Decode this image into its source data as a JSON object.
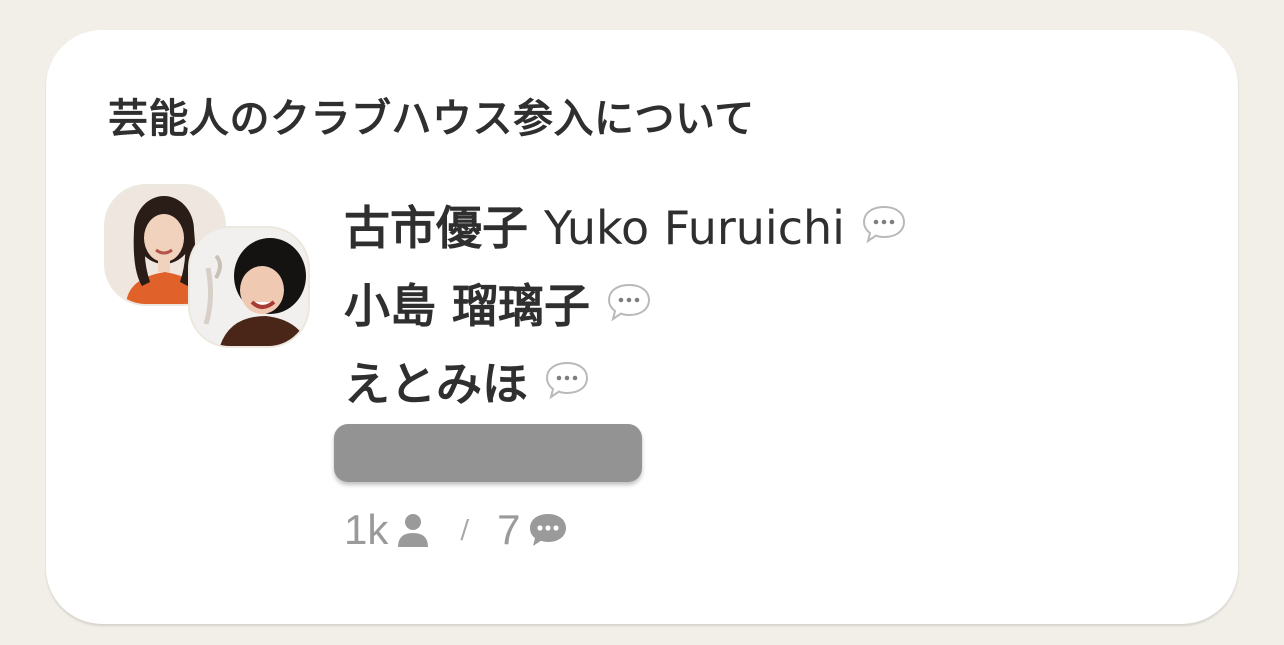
{
  "room": {
    "title": "芸能人のクラブハウス参入について",
    "speakers": [
      {
        "name": "古市優子",
        "name_latin": "Yuko Furuichi",
        "icon": "speech-bubble-icon"
      },
      {
        "name": "小島 瑠璃子",
        "name_latin": "",
        "icon": "speech-bubble-icon"
      },
      {
        "name": "えとみほ",
        "name_latin": "",
        "icon": "speech-bubble-icon"
      }
    ],
    "stats": {
      "listeners": "1k",
      "listeners_icon": "person-icon",
      "separator": "/",
      "speakers": "7",
      "speakers_icon": "chat-bubble-icon"
    }
  },
  "colors": {
    "background": "#f1efe7",
    "card": "#ffffff",
    "text": "#2f2f2f",
    "muted": "#9a9a9a",
    "redacted": "#939393"
  }
}
